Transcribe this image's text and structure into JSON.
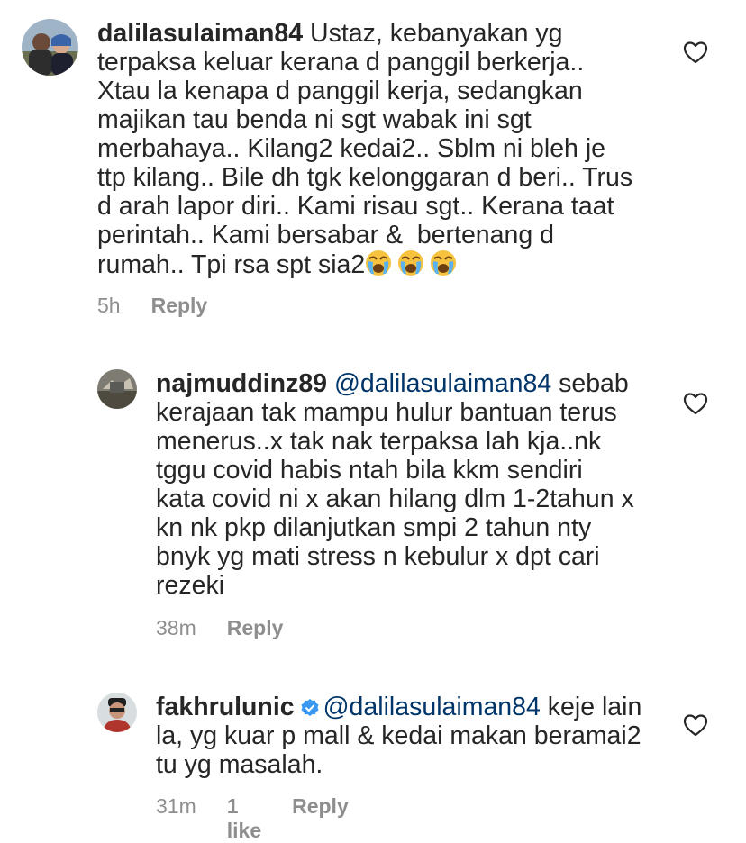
{
  "comments": [
    {
      "username": "dalilasulaiman84",
      "lines": [
        "Ustaz, kebanyakan yg",
        "terpaksa keluar kerana d panggil berkerja..",
        "Xtau la kenapa d panggil kerja, sedangkan",
        "majikan tau benda ni sgt wabak ini sgt",
        "merbahaya.. Kilang2 kedai2.. Sblm ni bleh je",
        "ttp kilang.. Bile dh tgk kelonggaran d beri.. Trus",
        "d arah lapor diri.. Kami risau sgt.. Kerana taat",
        "perintah.. Kami bersabar &  bertenang d",
        "rumah.. Tpi rsa spt sia2"
      ],
      "emojis": [
        "crying-face",
        "crying-face",
        "crying-face"
      ],
      "time": "5h",
      "reply_label": "Reply"
    },
    {
      "username": "najmuddinz89",
      "mention": "@dalilasulaiman84",
      "lines": [
        "sebab",
        "kerajaan tak mampu hulur bantuan terus",
        "menerus..x tak nak terpaksa lah kja..nk",
        "tggu covid habis ntah bila kkm sendiri",
        "kata covid ni x akan hilang dlm 1-2tahun x",
        "kn nk pkp dilanjutkan smpi 2 tahun nty",
        "bnyk yg mati stress n kebulur x dpt cari",
        "rezeki"
      ],
      "time": "38m",
      "reply_label": "Reply"
    },
    {
      "username": "fakhrulunic",
      "verified": true,
      "mention": "@dalilasulaiman84",
      "lines": [
        "keje lain",
        "la, yg kuar p mall & kedai makan beramai2",
        "tu yg masalah."
      ],
      "time": "31m",
      "likes": "1 like",
      "reply_label": "Reply"
    }
  ],
  "icons": {
    "heart": "heart-outline-icon",
    "verified": "verified-badge-icon",
    "emoji": "loudly-crying-face-emoji"
  },
  "colors": {
    "text": "#262626",
    "mention": "#003569",
    "meta": "#8e8e8e",
    "verified": "#3897f0"
  }
}
